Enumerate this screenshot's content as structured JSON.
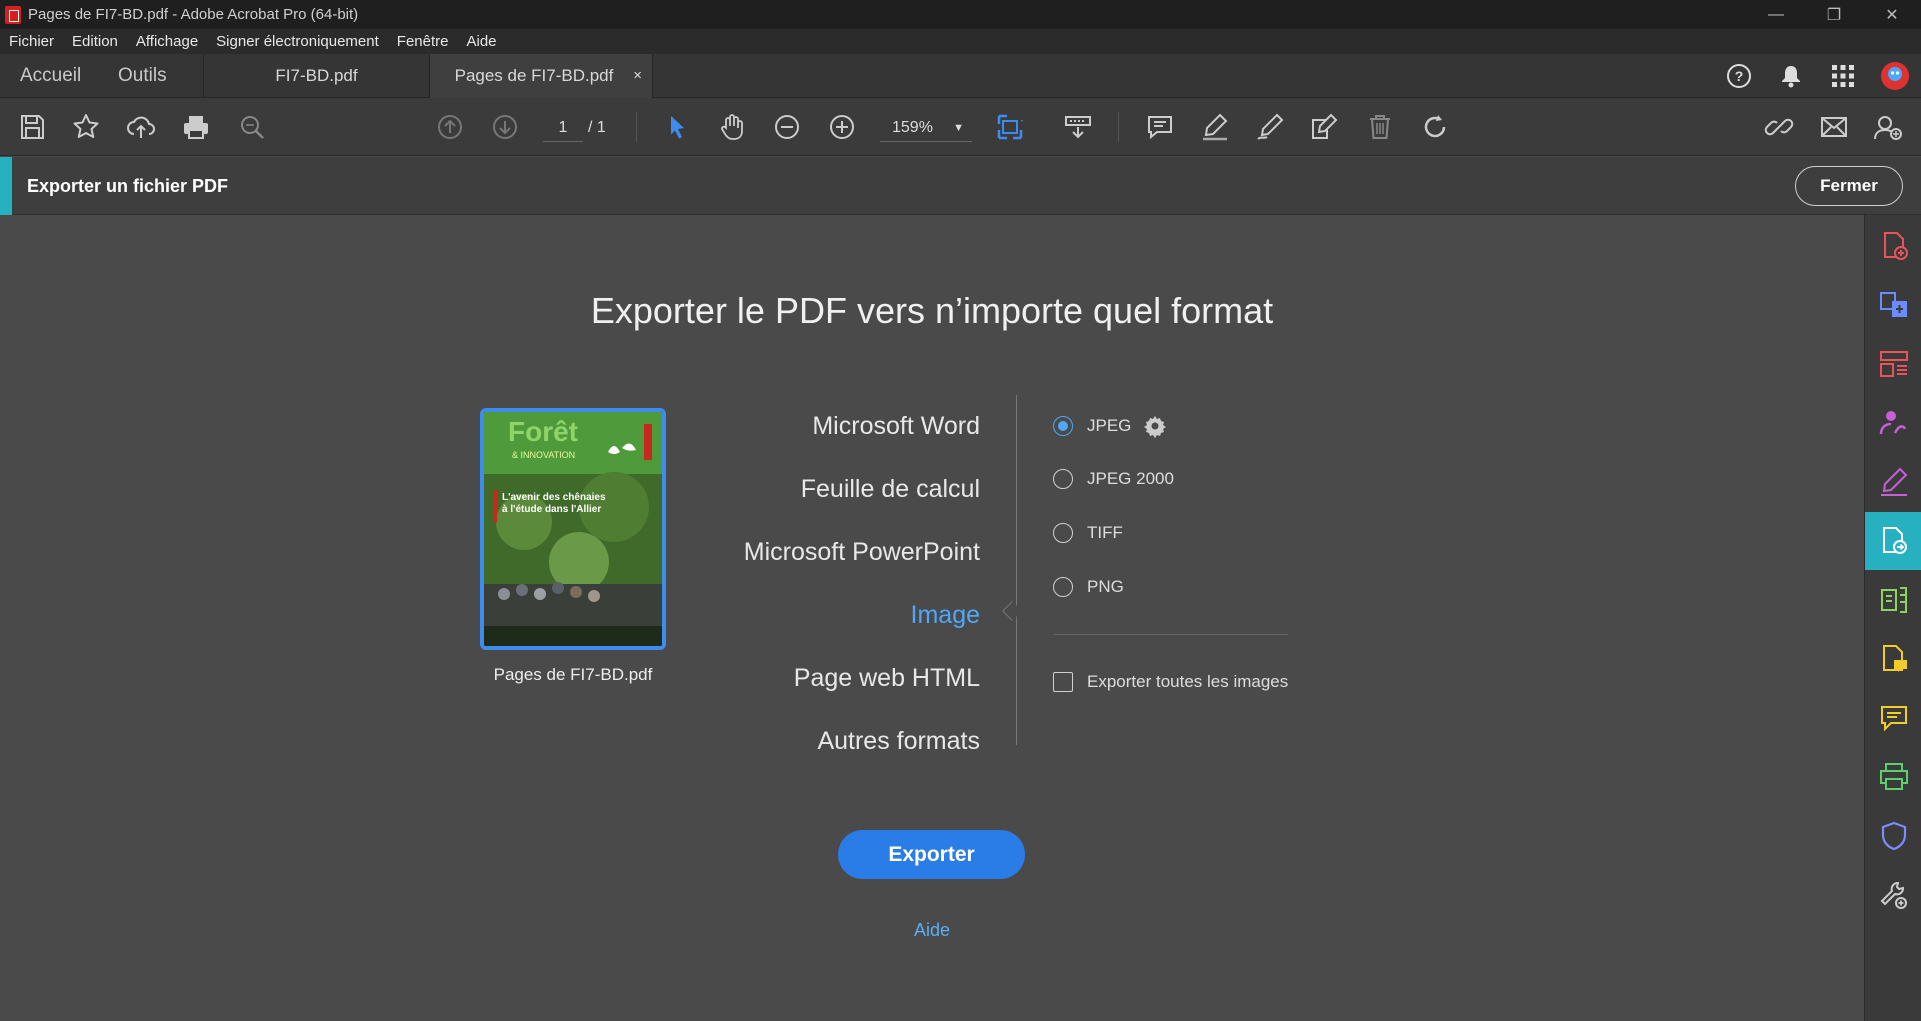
{
  "window": {
    "title": "Pages de FI7-BD.pdf - Adobe Acrobat Pro (64-bit)",
    "controls": [
      "minimize",
      "restore",
      "close"
    ]
  },
  "menu": [
    "Fichier",
    "Edition",
    "Affichage",
    "Signer électroniquement",
    "Fenêtre",
    "Aide"
  ],
  "tabs": {
    "home": "Accueil",
    "tools": "Outils",
    "documents": [
      {
        "label": "FI7-BD.pdf",
        "active": false
      },
      {
        "label": "Pages de FI7-BD.pdf",
        "active": true,
        "close": "×"
      }
    ]
  },
  "toolbar": {
    "page_current": "1",
    "page_total": "/ 1",
    "zoom": "159%",
    "icons": [
      "save-icon",
      "bookmark-star-icon",
      "upload-cloud-icon",
      "print-icon",
      "zoom-search-icon",
      "previous-page-icon",
      "next-page-icon",
      "select-cursor-icon",
      "hand-icon",
      "zoom-out-icon",
      "zoom-in-icon",
      "fit-page-icon",
      "scroll-mode-icon",
      "comment-icon",
      "highlight-icon",
      "draw-icon",
      "edit-icon",
      "delete-icon",
      "rotate-icon",
      "share-link-icon",
      "email-icon",
      "share-user-icon"
    ]
  },
  "export_bar": {
    "label": "Exporter un fichier PDF",
    "close_button": "Fermer"
  },
  "main": {
    "title": "Exporter le PDF vers n’importe quel format",
    "thumbnail_caption": "Pages de FI7-BD.pdf",
    "thumbnail_text": {
      "masthead": "Forêt",
      "sub": "& INNOVATION",
      "headline": "L'avenir des chênaies à l'étude dans l'Allier"
    },
    "formats": [
      {
        "label": "Microsoft Word",
        "active": false
      },
      {
        "label": "Feuille de calcul",
        "active": false
      },
      {
        "label": "Microsoft PowerPoint",
        "active": false
      },
      {
        "label": "Image",
        "active": true
      },
      {
        "label": "Page web HTML",
        "active": false
      },
      {
        "label": "Autres formats",
        "active": false
      }
    ],
    "image_options": [
      {
        "label": "JPEG",
        "selected": true,
        "has_settings": true
      },
      {
        "label": "JPEG 2000",
        "selected": false
      },
      {
        "label": "TIFF",
        "selected": false
      },
      {
        "label": "PNG",
        "selected": false
      }
    ],
    "export_all_images": {
      "label": "Exporter toutes les images",
      "checked": false
    },
    "export_button": "Exporter",
    "help_link": "Aide"
  },
  "colors": {
    "accent_blue": "#2a7ce6",
    "link_blue": "#4ea7f7",
    "teal": "#26b0c0"
  }
}
